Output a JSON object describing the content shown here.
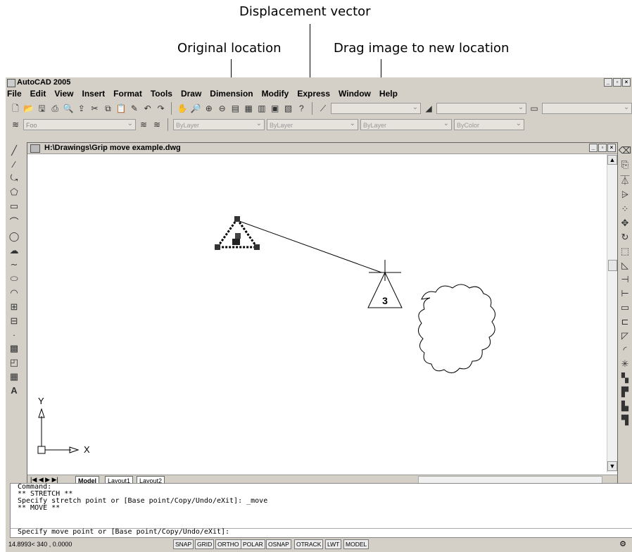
{
  "callouts": {
    "displacement": "Displacement vector",
    "original": "Original location",
    "drag": "Drag image to new location"
  },
  "window": {
    "title": "AutoCAD 2005"
  },
  "menu": [
    "File",
    "Edit",
    "View",
    "Insert",
    "Format",
    "Tools",
    "Draw",
    "Dimension",
    "Modify",
    "Express",
    "Window",
    "Help"
  ],
  "layer_toolbar": {
    "layer_name": "Foo",
    "color": "ByLayer",
    "linetype": "ByLayer",
    "lineweight": "ByLayer",
    "plotstyle": "ByColor"
  },
  "drawing": {
    "title": "H:\\Drawings\\Grip move example.dwg",
    "block_label": "3",
    "ucs_x": "X",
    "ucs_y": "Y"
  },
  "tabs": [
    "Model",
    "Layout1",
    "Layout2"
  ],
  "command": {
    "lines": [
      "Command:",
      "** STRETCH **",
      "Specify stretch point or [Base point/Copy/Undo/eXit]: _move",
      "** MOVE **"
    ],
    "prompt": "Specify move point or [Base point/Copy/Undo/eXit]:"
  },
  "status": {
    "coords": "14.8993< 340 , 0.0000",
    "buttons": [
      "SNAP",
      "GRID",
      "ORTHO",
      "POLAR",
      "OSNAP",
      "OTRACK",
      "LWT",
      "MODEL"
    ]
  }
}
